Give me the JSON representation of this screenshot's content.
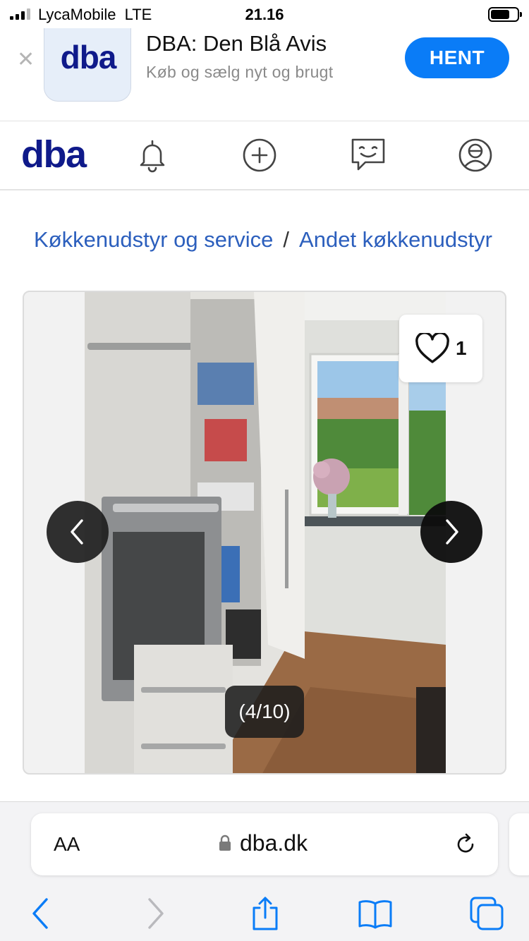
{
  "status_bar": {
    "carrier": "LycaMobile",
    "network": "LTE",
    "time": "21.16"
  },
  "app_banner": {
    "icon_text": "dba",
    "app_name": "DBA: Den Blå Avis",
    "app_subtitle": "Køb og sælg nyt og brugt",
    "get_button": "HENT"
  },
  "header": {
    "logo": "dba",
    "nav_icons": [
      "bell-icon",
      "plus-circle-icon",
      "chat-icon",
      "user-profile-icon"
    ]
  },
  "breadcrumb": {
    "items": [
      "Køkkenudstyr og service",
      "Andet køkkenudstyr"
    ],
    "separator": "/"
  },
  "gallery": {
    "favorite_count": "1",
    "counter": "(4/10)",
    "current_image": 4,
    "total_images": 10
  },
  "safari": {
    "text_size_label": "AA",
    "url": "dba.dk",
    "toolbar_icons": [
      "back-icon",
      "forward-icon",
      "share-icon",
      "bookmarks-icon",
      "tabs-icon"
    ]
  },
  "colors": {
    "brand_navy": "#0f1a8a",
    "link_blue": "#2c5fbd",
    "ios_blue": "#0a7cf7"
  }
}
